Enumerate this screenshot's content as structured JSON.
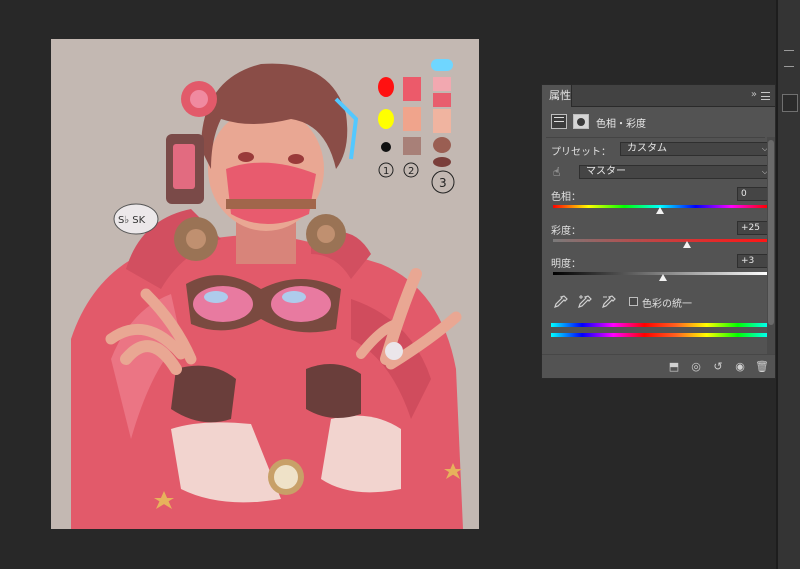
{
  "panel": {
    "tab_label": "属性",
    "collapse_glyph": "»",
    "adjustment_title": "色相・彩度",
    "preset_label": "プリセット：",
    "preset_value": "カスタム",
    "channel_value": "マスター",
    "hue_label": "色相：",
    "hue_value": "0",
    "hue_fraction": 0.5,
    "saturation_label": "彩度：",
    "saturation_value": "+25",
    "saturation_fraction": 0.625,
    "lightness_label": "明度：",
    "lightness_value": "+3",
    "lightness_fraction": 0.515,
    "colorize_label": "色彩の統一",
    "colorize_checked": false,
    "icons": {
      "adjustment": "hue-saturation-icon",
      "mask": "layer-mask-icon",
      "target": "hand-target-icon",
      "eyedropper": "eyedropper-icon",
      "eyedropper_add": "eyedropper-plus-icon",
      "eyedropper_sub": "eyedropper-minus-icon",
      "clip": "clip-to-layer-icon",
      "view_prev": "view-previous-icon",
      "reset": "reset-icon",
      "visibility": "eye-icon",
      "delete": "trash-icon"
    }
  },
  "colors": {
    "workspace": "#282828",
    "canvas": "#c3b8b2",
    "panel": "#535353",
    "jacket": "#e25a6a",
    "skin": "#e9a793",
    "hair": "#8a4d47"
  },
  "artwork": {
    "sign_text": "S♭ SK",
    "palette_numbers": [
      "1",
      "2",
      "3"
    ]
  }
}
